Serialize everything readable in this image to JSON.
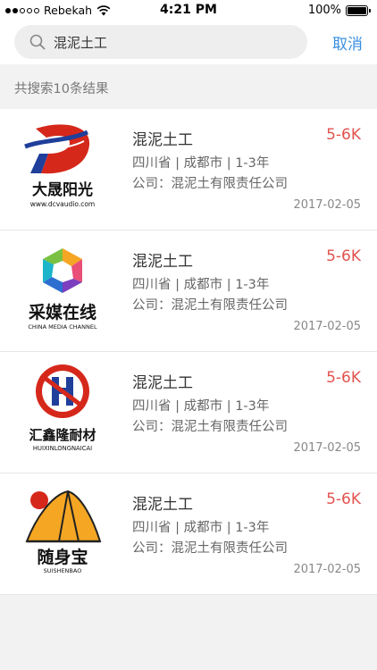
{
  "status_bar": {
    "carrier": "Rebekah",
    "time": "4:21 PM",
    "battery": "100%",
    "battery_level": 1.0,
    "signal_dots_filled": 2,
    "signal_dots_total": 5
  },
  "search": {
    "value": "混泥土工",
    "cancel_label": "取消"
  },
  "result_count": "共搜索10条结果",
  "colors": {
    "accent": "#3a8fe0",
    "salary": "#e2534e"
  },
  "results": [
    {
      "title": "混泥土工",
      "salary": "5-6K",
      "meta": "四川省 | 成都市 | 1-3年",
      "company": "公司：混泥土有限责任公司",
      "date": "2017-02-05",
      "logo": {
        "name": "大晟阳光",
        "sub": "www.dcvaudio.com",
        "icon": "d-swoosh-logo"
      }
    },
    {
      "title": "混泥土工",
      "salary": "5-6K",
      "meta": "四川省 | 成都市 | 1-3年",
      "company": "公司：混泥土有限责任公司",
      "date": "2017-02-05",
      "logo": {
        "name": "采媒在线",
        "sub": "CHINA MEDIA CHANNEL",
        "icon": "rainbow-hexagon-logo"
      }
    },
    {
      "title": "混泥土工",
      "salary": "5-6K",
      "meta": "四川省 | 成都市 | 1-3年",
      "company": "公司：混泥土有限责任公司",
      "date": "2017-02-05",
      "logo": {
        "name": "汇鑫隆耐材",
        "sub": "HUIXINLONGNAICAI",
        "icon": "h-circle-logo"
      }
    },
    {
      "title": "混泥土工",
      "salary": "5-6K",
      "meta": "四川省 | 成都市 | 1-3年",
      "company": "公司：混泥土有限责任公司",
      "date": "2017-02-05",
      "logo": {
        "name": "随身宝",
        "sub": "SUISHENBAO",
        "icon": "tent-sun-logo"
      }
    }
  ]
}
